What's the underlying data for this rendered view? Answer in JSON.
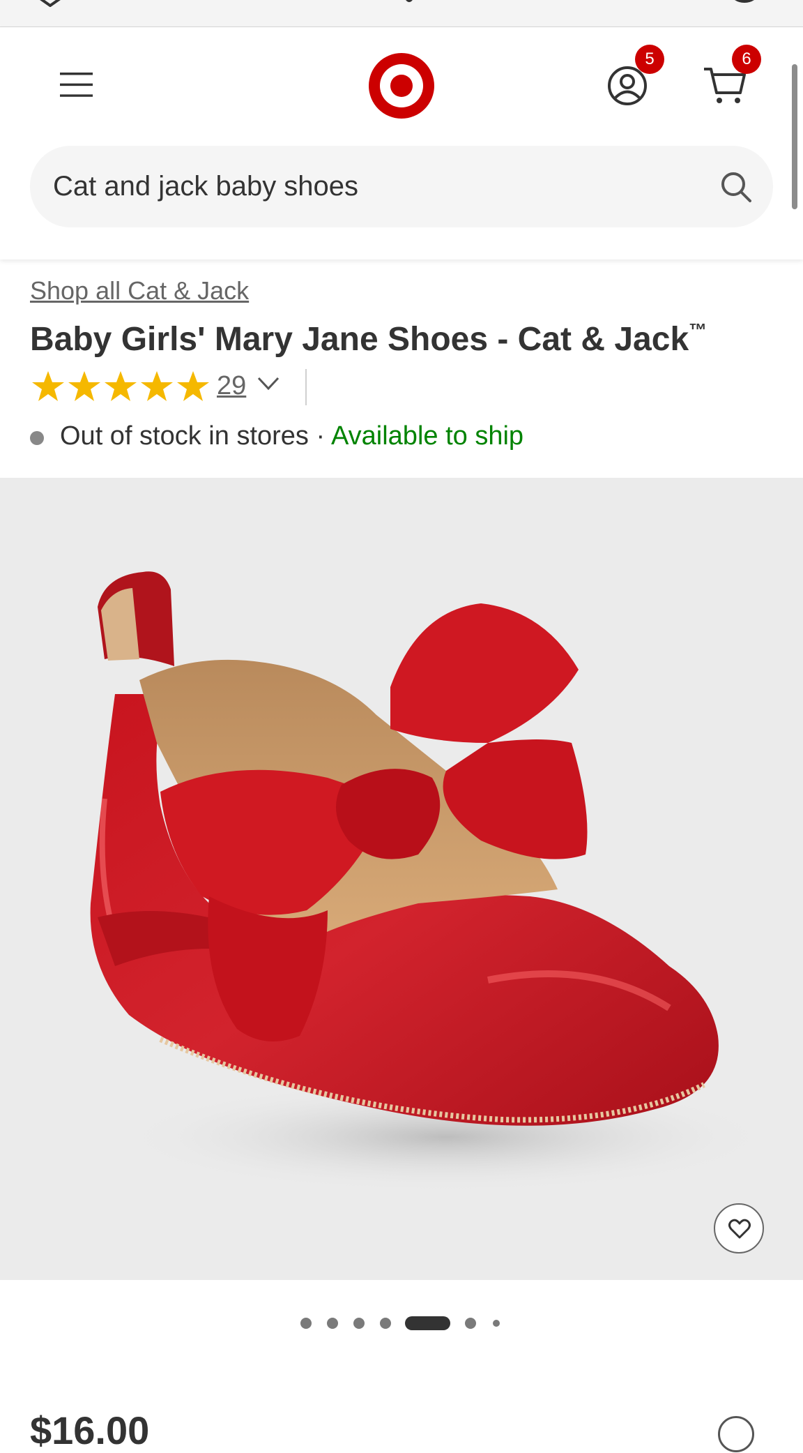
{
  "header": {
    "cart_badge": "6",
    "account_badge": "5"
  },
  "search": {
    "value": "Cat and jack baby shoes"
  },
  "product": {
    "brand_link": "Shop all Cat & Jack",
    "title": "Baby Girls' Mary Jane Shoes - Cat & Jack",
    "title_mark": "™",
    "rating": 5,
    "review_count": "29",
    "stock_store": "Out of stock in stores · ",
    "stock_ship": "Available to ship",
    "price": "$16.00"
  },
  "carousel": {
    "total": 7,
    "active_index": 4
  },
  "colors": {
    "brand_red": "#cc0000",
    "ship_green": "#008300",
    "star_gold": "#f5b800"
  }
}
